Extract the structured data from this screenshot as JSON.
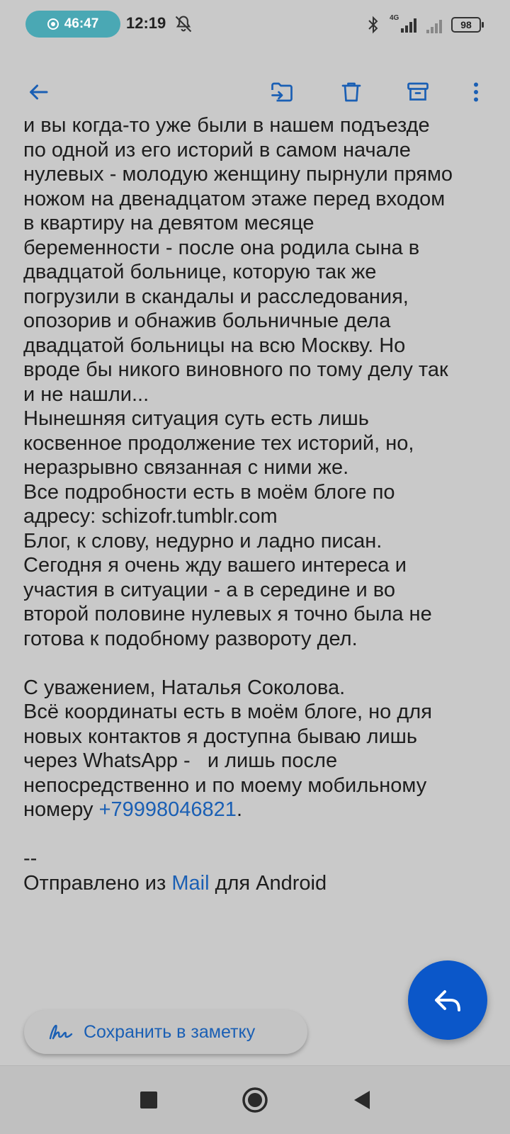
{
  "status_bar": {
    "recording_time": "46:47",
    "clock": "12:19",
    "network": "4G",
    "battery": "98"
  },
  "toolbar": {
    "icons": [
      "back-arrow-icon",
      "move-to-folder-icon",
      "trash-icon",
      "archive-icon",
      "more-vertical-icon"
    ]
  },
  "body": {
    "lines": [
      "и вы когда-то уже были в нашем подъезде",
      "по одной из его историй в самом начале",
      "нулевых - молодую женщину пырнули прямо",
      "ножом на двенадцатом этаже перед входом",
      "в квартиру на девятом месяце",
      "беременности - после она родила сына в",
      "двадцатой больнице, которую так же",
      "погрузили в скандалы и расследования,",
      "опозорив и обнажив больничные дела",
      "двадцатой больницы на всю Москву. Но",
      "вроде бы никого виновного по тому делу так",
      "и не нашли...",
      "Нынешняя ситуация суть есть лишь",
      "косвенное продолжение тех историй, но,",
      "неразрывно связанная с ними же.",
      "Все подробности есть в моём блоге по",
      "адресу: schizofr.tumblr.com",
      "Блог, к слову, недурно и ладно писан.",
      "Сегодня я очень жду вашего интереса и",
      "участия в ситуации - а в середине и во",
      "второй половине нулевых я точно была не",
      "готова к подобному развороту дел."
    ],
    "signature": "С уважением, Наталья Соколова.",
    "contact_lines": [
      "Всё координаты есть в моём блоге, но для",
      "новых контактов я доступна бываю лишь",
      "через WhatsApp -   и лишь после",
      "непосредственно и по моему мобильному"
    ],
    "phone_prefix": "номеру ",
    "phone_number": "+79998046821",
    "phone_suffix": ".",
    "sig_separator": "--",
    "sent_from_prefix": "Отправлено из ",
    "sent_from_link": "Mail",
    "sent_from_suffix": " для Android"
  },
  "note_chip": {
    "label": "Сохранить в заметку"
  },
  "colors": {
    "accent": "#0b57c9",
    "link": "#1a5fb4",
    "background": "#c9c9c9"
  }
}
